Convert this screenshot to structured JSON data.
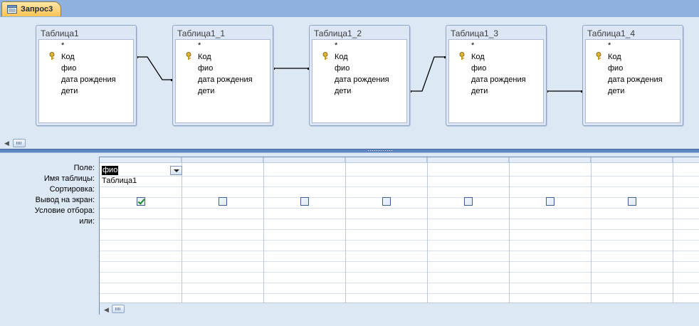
{
  "tab": {
    "label": "Запрос3",
    "icon": "query-icon"
  },
  "tables": [
    {
      "title": "Таблица1",
      "fields": [
        "*",
        "Код",
        "фио",
        "дата рождения",
        "дети"
      ],
      "key_field": "Код"
    },
    {
      "title": "Таблица1_1",
      "fields": [
        "*",
        "Код",
        "фио",
        "дата рождения",
        "дети"
      ],
      "key_field": "Код"
    },
    {
      "title": "Таблица1_2",
      "fields": [
        "*",
        "Код",
        "фио",
        "дата рождения",
        "дети"
      ],
      "key_field": "Код"
    },
    {
      "title": "Таблица1_3",
      "fields": [
        "*",
        "Код",
        "фио",
        "дата рождения",
        "дети"
      ],
      "key_field": "Код"
    },
    {
      "title": "Таблица1_4",
      "fields": [
        "*",
        "Код",
        "фио",
        "дата рождения",
        "дети"
      ],
      "key_field": "Код"
    }
  ],
  "grid": {
    "row_labels": {
      "field": "Поле:",
      "table": "Имя таблицы:",
      "sort": "Сортировка:",
      "show": "Вывод на экран:",
      "criteria": "Условие отбора:",
      "or": "или:"
    },
    "columns": [
      {
        "field": "фио",
        "table": "Таблица1",
        "show": true
      },
      {
        "field": "",
        "table": "",
        "show": false
      },
      {
        "field": "",
        "table": "",
        "show": false
      },
      {
        "field": "",
        "table": "",
        "show": false
      },
      {
        "field": "",
        "table": "",
        "show": false
      },
      {
        "field": "",
        "table": "",
        "show": false
      },
      {
        "field": "",
        "table": "",
        "show": false
      }
    ]
  },
  "colors": {
    "tab_active": "#ffc453",
    "tabstrip": "#8fb1e0",
    "pane_background": "#dde8f5",
    "splitter": "#5f86c3",
    "checkbox_check": "#1d8a27"
  }
}
